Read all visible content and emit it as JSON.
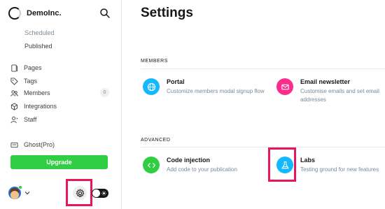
{
  "sidebar": {
    "brand": "DemoInc.",
    "sub_items": [
      "Scheduled",
      "Published"
    ],
    "nav": [
      {
        "label": "Pages",
        "icon": "page-icon"
      },
      {
        "label": "Tags",
        "icon": "tag-icon"
      },
      {
        "label": "Members",
        "icon": "members-icon",
        "count": "0"
      },
      {
        "label": "Integrations",
        "icon": "integrations-icon"
      },
      {
        "label": "Staff",
        "icon": "staff-icon"
      }
    ],
    "plan": "Ghost(Pro)",
    "upgrade_label": "Upgrade"
  },
  "main": {
    "title": "Settings",
    "sections": [
      {
        "label": "MEMBERS",
        "cards": [
          {
            "title": "Portal",
            "desc": "Customize members modal signup flow",
            "color": "#14b8ff",
            "icon": "globe-icon"
          },
          {
            "title": "Email newsletter",
            "desc": "Customise emails and set email addresses",
            "color": "#fb2d8d",
            "icon": "mail-icon"
          }
        ]
      },
      {
        "label": "ADVANCED",
        "cards": [
          {
            "title": "Code injection",
            "desc": "Add code to your publication",
            "color": "#30cf43",
            "icon": "code-icon"
          },
          {
            "title": "Labs",
            "desc": "Testing ground for new features",
            "color": "#14b8ff",
            "icon": "flask-icon"
          }
        ]
      }
    ]
  },
  "colors": {
    "accent_green": "#30cf43",
    "highlight": "#e6175c"
  }
}
